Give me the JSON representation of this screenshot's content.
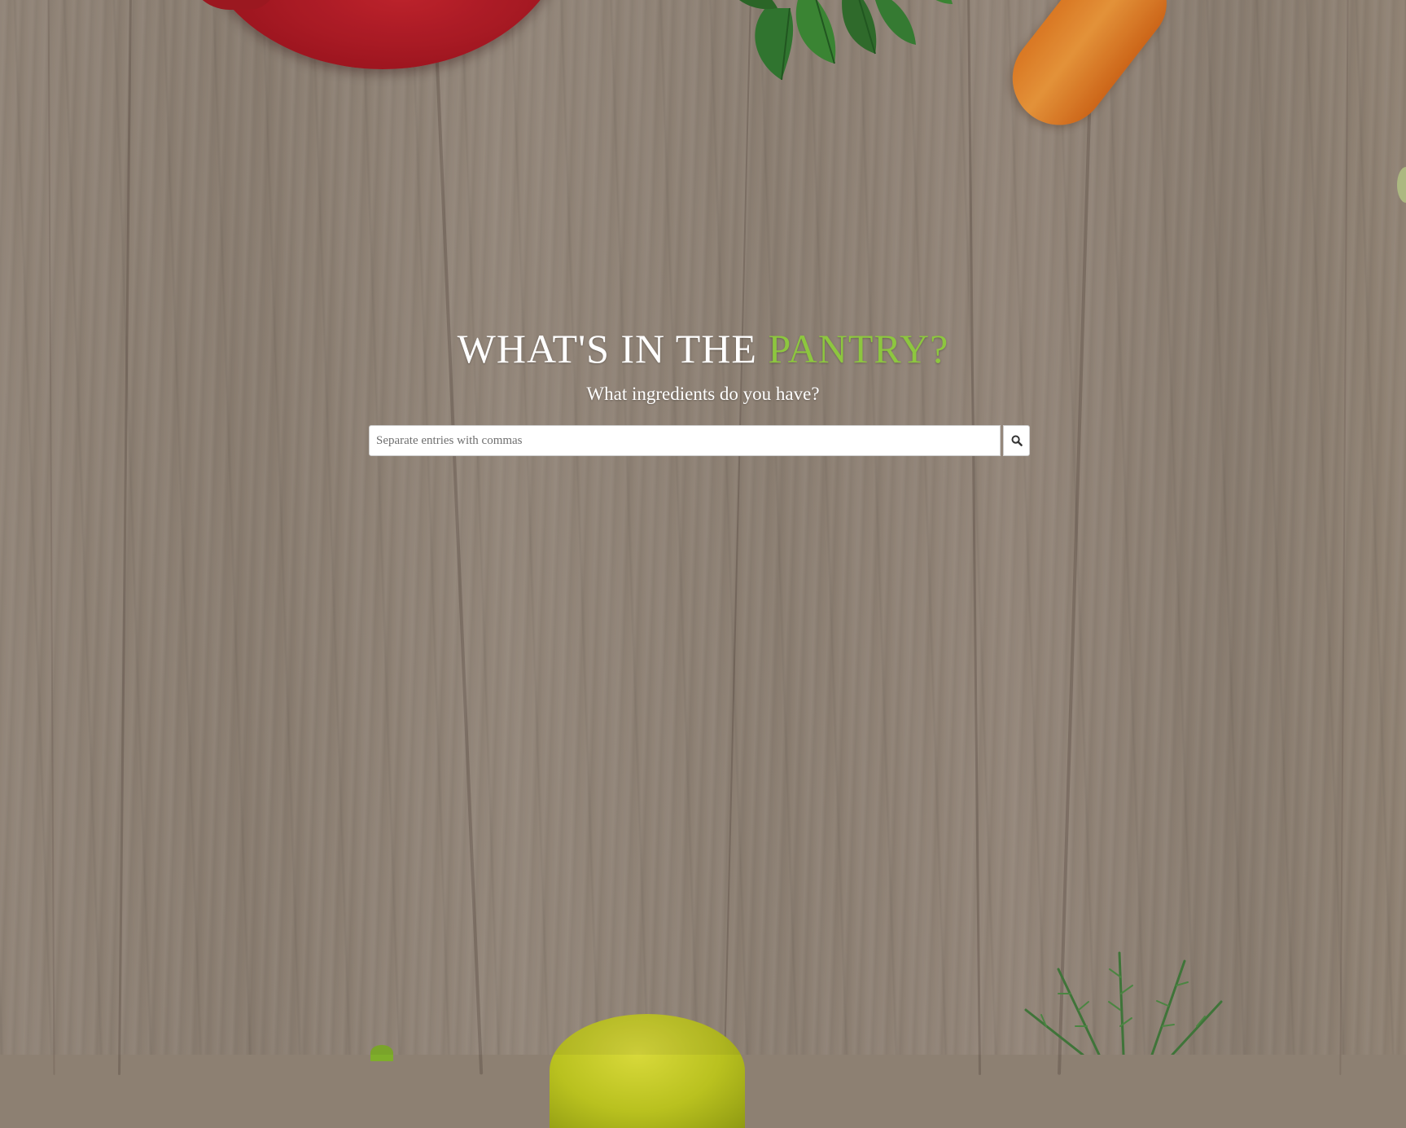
{
  "hero": {
    "title_main": "WHAT'S IN THE ",
    "title_accent": "PANTRY?",
    "subtitle": "What ingredients do you have?"
  },
  "search": {
    "placeholder": "Separate entries with commas",
    "value": "",
    "button_icon": "search-icon"
  },
  "colors": {
    "accent": "#8dc63f",
    "title": "#ffffff",
    "background": "#8d8072"
  }
}
